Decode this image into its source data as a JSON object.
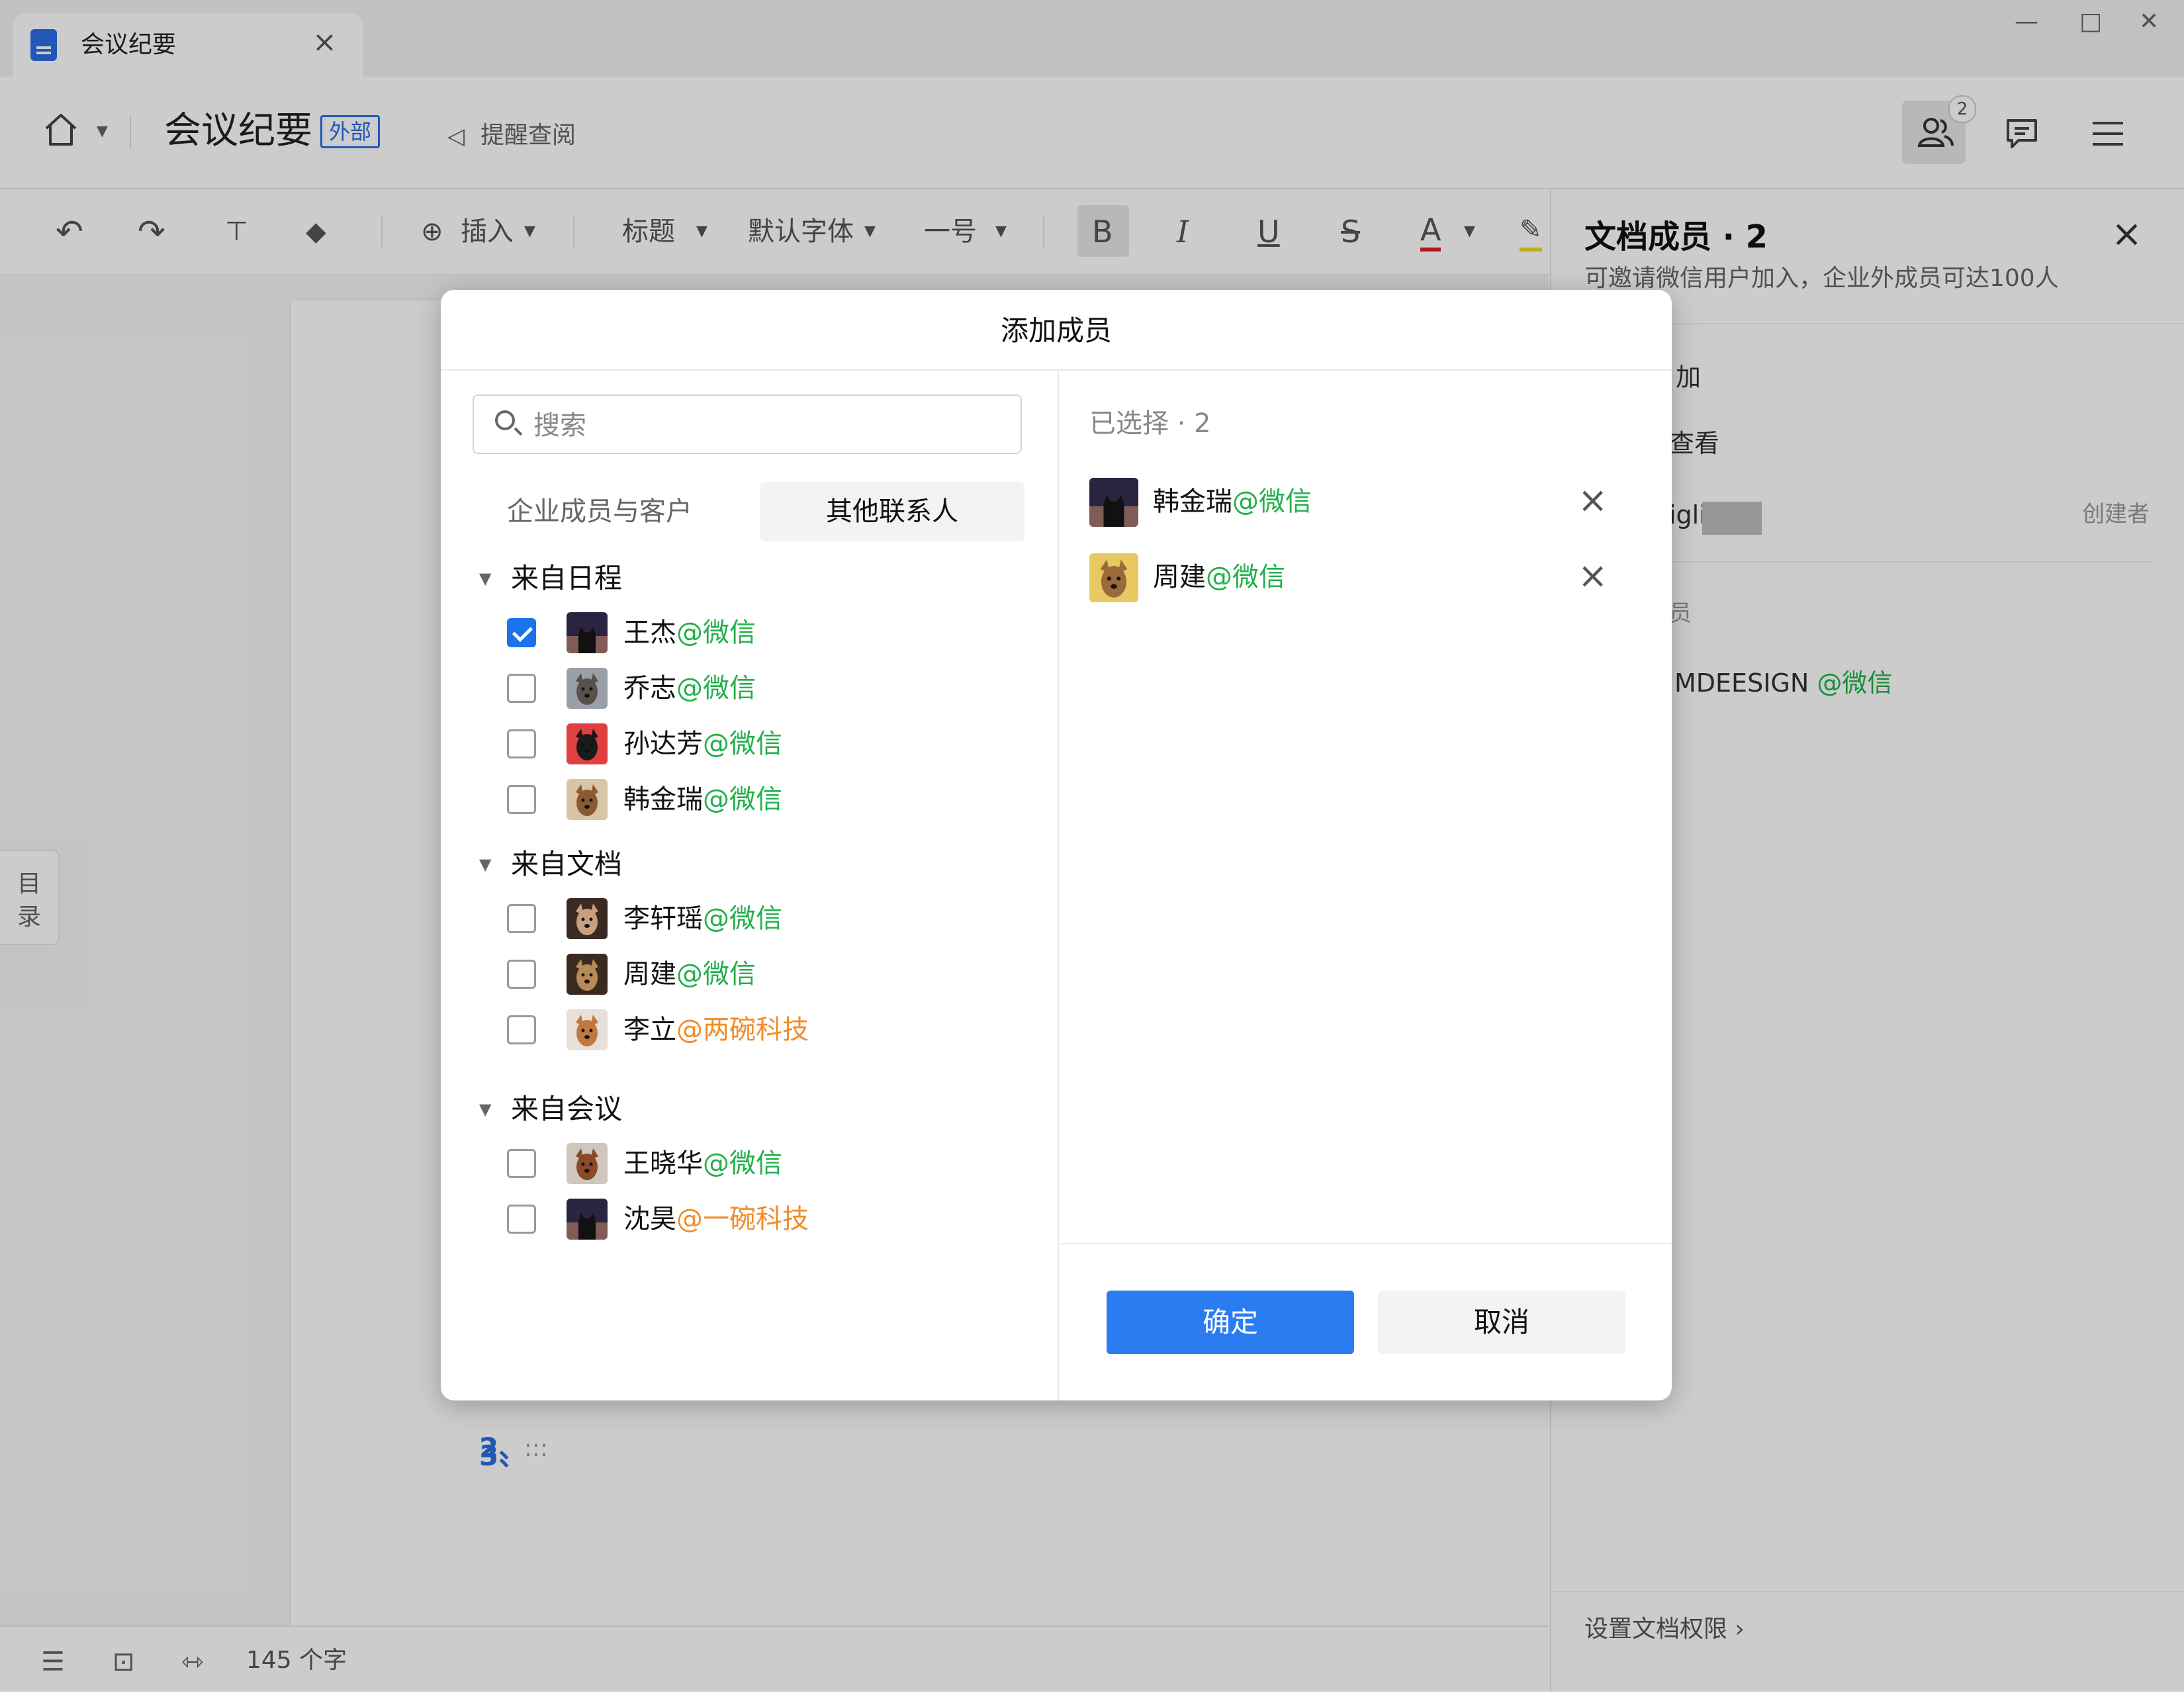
{
  "window": {
    "tab_title": "会议纪要",
    "tab_close": "×",
    "min": "—",
    "max": "□",
    "close": "✕"
  },
  "header": {
    "doc_title": "会议纪要",
    "badge": "外部",
    "remind": "提醒查阅",
    "members_count": "2"
  },
  "toolbar": {
    "insert": "插入",
    "heading": "标题",
    "font": "默认字体",
    "size": "一号",
    "bold": "B",
    "italic": "I",
    "underline": "U",
    "strike": "S",
    "fontcolor": "A"
  },
  "editor": {
    "toc": [
      "目",
      "录"
    ],
    "list_num_3": "3、",
    "list_dots": "…",
    "word_count": "145 个字"
  },
  "panel": {
    "title": "文档成员 · 2",
    "subtitle": "可邀请微信用户加入，企业外成员可达100人",
    "add": "加",
    "view": "查看",
    "owner_name_fragment": "iglio",
    "owner_role": "创建者",
    "section_fragment": "员",
    "member_name_fragment": "MDEESIGN",
    "member_tag": "@微信",
    "footer": "设置文档权限 ›"
  },
  "modal": {
    "title": "添加成员",
    "search_placeholder": "搜索",
    "tabs": [
      "企业成员与客户",
      "其他联系人"
    ],
    "groups": [
      {
        "label": "来自日程",
        "people": [
          {
            "name": "王杰",
            "tag": "@微信",
            "tag_type": "wx",
            "checked": true,
            "avatar": "cat-silhouette"
          },
          {
            "name": "乔志",
            "tag": "@微信",
            "tag_type": "wx",
            "checked": false,
            "avatar": "dog-grey"
          },
          {
            "name": "孙达芳",
            "tag": "@微信",
            "tag_type": "wx",
            "checked": false,
            "avatar": "dog-black"
          },
          {
            "name": "韩金瑞",
            "tag": "@微信",
            "tag_type": "wx",
            "checked": false,
            "avatar": "dog-brown"
          }
        ]
      },
      {
        "label": "来自文档",
        "people": [
          {
            "name": "李轩瑶",
            "tag": "@微信",
            "tag_type": "wx",
            "checked": false,
            "avatar": "dog-collie"
          },
          {
            "name": "周建",
            "tag": "@微信",
            "tag_type": "wx",
            "checked": false,
            "avatar": "dog-tan"
          },
          {
            "name": "李立",
            "tag": "@两碗科技",
            "tag_type": "co",
            "checked": false,
            "avatar": "dog-corgi"
          }
        ]
      },
      {
        "label": "来自会议",
        "people": [
          {
            "name": "王晓华",
            "tag": "@微信",
            "tag_type": "wx",
            "checked": false,
            "avatar": "dog-spaniel"
          },
          {
            "name": "沈昊",
            "tag": "@一碗科技",
            "tag_type": "co",
            "checked": false,
            "avatar": "cat-silhouette"
          }
        ]
      }
    ],
    "selected_label": "已选择 · 2",
    "selected": [
      {
        "name": "韩金瑞",
        "tag": "@微信",
        "avatar": "cat-silhouette"
      },
      {
        "name": "周建",
        "tag": "@微信",
        "avatar": "dog-yellow"
      }
    ],
    "ok": "确定",
    "cancel": "取消"
  },
  "colors": {
    "accent": "#2b7cf0",
    "wx_tag": "#22b04a",
    "company_tag": "#f08c2a"
  }
}
